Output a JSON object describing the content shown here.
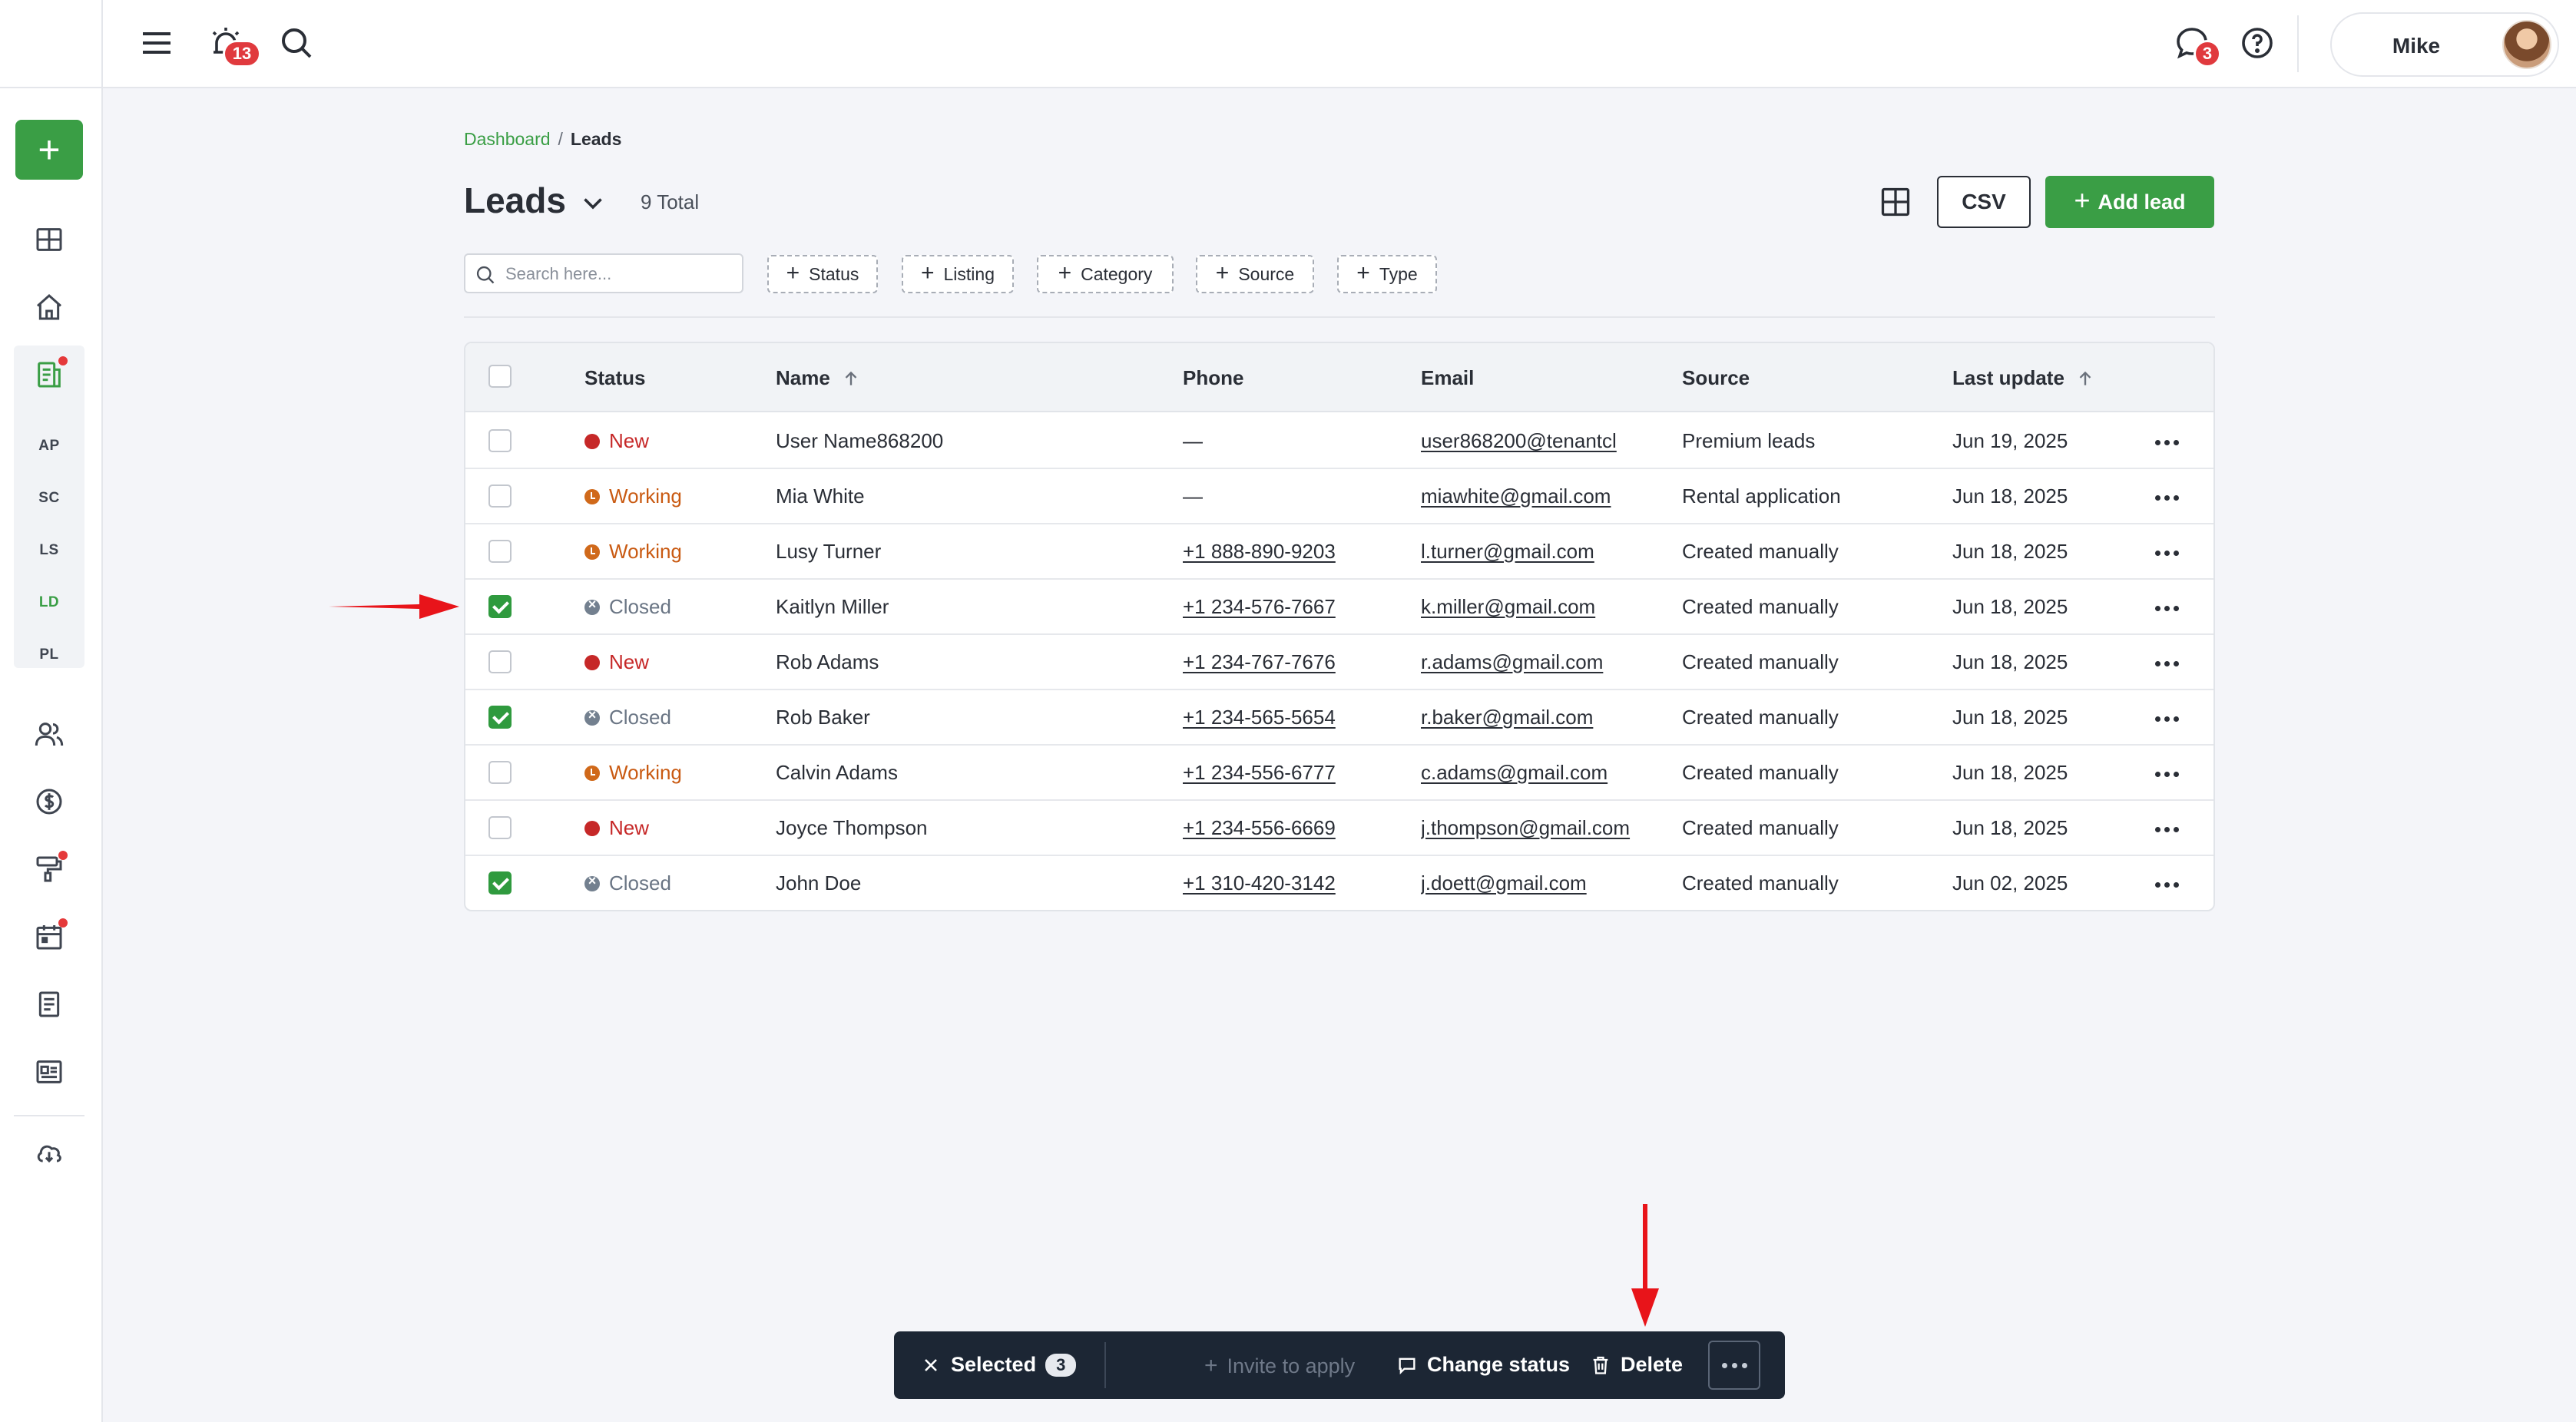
{
  "topbar": {
    "notifications_badge": "13",
    "messages_badge": "3",
    "user_name": "Mike"
  },
  "sidebar": {
    "text_items": [
      {
        "label": "AP"
      },
      {
        "label": "SC"
      },
      {
        "label": "LS"
      },
      {
        "label": "LD"
      },
      {
        "label": "PL"
      }
    ],
    "accent_color": "#3a9e45"
  },
  "breadcrumb": {
    "root": "Dashboard",
    "separator": "/",
    "current": "Leads"
  },
  "page": {
    "title": "Leads",
    "total": "9 Total",
    "csv_label": "CSV",
    "add_label": "Add lead"
  },
  "search": {
    "placeholder": "Search here..."
  },
  "filters": [
    {
      "label": "Status"
    },
    {
      "label": "Listing"
    },
    {
      "label": "Category"
    },
    {
      "label": "Source"
    },
    {
      "label": "Type"
    }
  ],
  "table": {
    "columns": {
      "status": "Status",
      "name": "Name",
      "phone": "Phone",
      "email": "Email",
      "source": "Source",
      "last_update": "Last update"
    },
    "rows": [
      {
        "checked": false,
        "status": "New",
        "status_type": "new",
        "name": "User Name868200",
        "phone": "—",
        "email": "user868200@tenantcl",
        "source": "Premium leads",
        "updated": "Jun 19, 2025"
      },
      {
        "checked": false,
        "status": "Working",
        "status_type": "working",
        "name": "Mia White",
        "phone": "—",
        "email": "miawhite@gmail.com",
        "source": "Rental application",
        "updated": "Jun 18, 2025"
      },
      {
        "checked": false,
        "status": "Working",
        "status_type": "working",
        "name": "Lusy Turner",
        "phone": "+1 888-890-9203",
        "email": "l.turner@gmail.com",
        "source": "Created manually",
        "updated": "Jun 18, 2025"
      },
      {
        "checked": true,
        "status": "Closed",
        "status_type": "closed",
        "name": "Kaitlyn Miller",
        "phone": "+1 234-576-7667",
        "email": "k.miller@gmail.com",
        "source": "Created manually",
        "updated": "Jun 18, 2025"
      },
      {
        "checked": false,
        "status": "New",
        "status_type": "new",
        "name": "Rob Adams",
        "phone": "+1 234-767-7676",
        "email": "r.adams@gmail.com",
        "source": "Created manually",
        "updated": "Jun 18, 2025"
      },
      {
        "checked": true,
        "status": "Closed",
        "status_type": "closed",
        "name": "Rob Baker",
        "phone": "+1 234-565-5654",
        "email": "r.baker@gmail.com",
        "source": "Created manually",
        "updated": "Jun 18, 2025"
      },
      {
        "checked": false,
        "status": "Working",
        "status_type": "working",
        "name": "Calvin Adams",
        "phone": "+1 234-556-6777",
        "email": "c.adams@gmail.com",
        "source": "Created manually",
        "updated": "Jun 18, 2025"
      },
      {
        "checked": false,
        "status": "New",
        "status_type": "new",
        "name": "Joyce Thompson",
        "phone": "+1 234-556-6669",
        "email": "j.thompson@gmail.com",
        "source": "Created manually",
        "updated": "Jun 18, 2025"
      },
      {
        "checked": true,
        "status": "Closed",
        "status_type": "closed",
        "name": "John Doe",
        "phone": "+1 310-420-3142",
        "email": "j.doett@gmail.com",
        "source": "Created manually",
        "updated": "Jun 02, 2025"
      }
    ]
  },
  "actionbar": {
    "selected_label": "Selected",
    "selected_count": "3",
    "invite_label": "Invite to apply",
    "change_status_label": "Change status",
    "delete_label": "Delete"
  },
  "colors": {
    "status_new": "#c62828",
    "status_working": "#c95a12",
    "status_closed": "#6a7584",
    "annotation_arrow": "#e8141a"
  }
}
